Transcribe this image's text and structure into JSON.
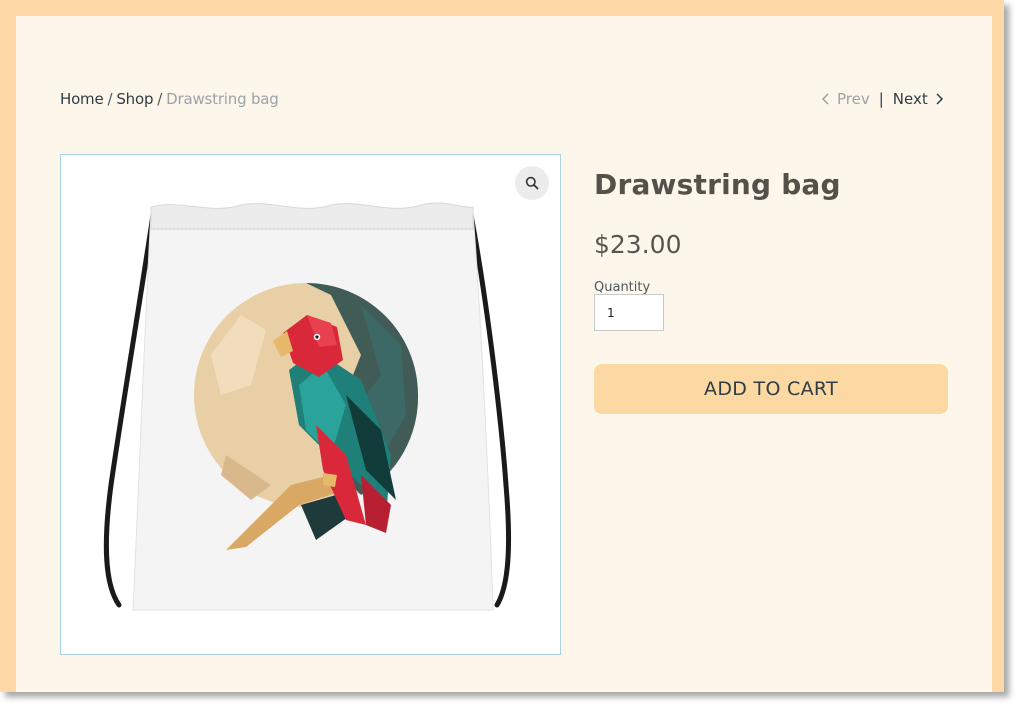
{
  "breadcrumb": {
    "home": "Home",
    "shop": "Shop",
    "current": "Drawstring bag",
    "separator": "/"
  },
  "pager": {
    "prev": "Prev",
    "divider": "|",
    "next": "Next"
  },
  "product": {
    "title": "Drawstring bag",
    "price": "$23.00",
    "quantity_label": "Quantity",
    "quantity_value": "1",
    "add_to_cart": "ADD TO CART",
    "image_subject": "white drawstring bag with geometric parrot and sun illustration"
  },
  "icons": {
    "zoom": "magnifier-icon",
    "prev": "chevron-left-icon",
    "next": "chevron-right-icon"
  },
  "colors": {
    "frame": "#fdd8a4",
    "page_background": "#fdf6ea",
    "button": "#fcd9a2",
    "text_dark": "#2f3d44",
    "text_muted": "#9aa3a8"
  }
}
